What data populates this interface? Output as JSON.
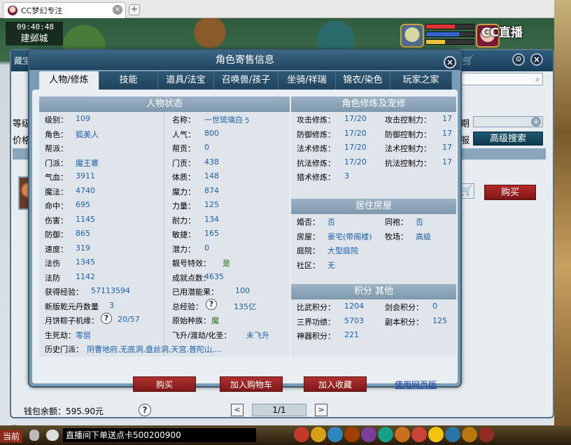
{
  "browser": {
    "tab_title": "CC梦幻专注",
    "tab_close": "×",
    "new_tab": "+"
  },
  "hud": {
    "time": "09:40:48",
    "location": "建邺城",
    "logo": "CC直播"
  },
  "shop": {
    "title": "藏宝",
    "level_label": "等级",
    "price_label": "价格",
    "right_label1": "期",
    "right_label2": "服",
    "advanced_search": "高级搜索",
    "buy": "购买",
    "wallet": "钱包余额：595.90元",
    "help": "?",
    "page": "1/1",
    "prev": "<",
    "next": ">"
  },
  "dialog": {
    "title": "角色寄售信息",
    "close": "×",
    "tabs": [
      "人物/修炼",
      "技能",
      "道具/法宝",
      "召唤兽/孩子",
      "坐骑/祥瑞",
      "锦衣/染色",
      "玩家之家"
    ],
    "left_header": "人物状态",
    "left_rows": [
      {
        "k1": "级别：",
        "v1": "109",
        "k2": "名称：",
        "v2": "一世琉璃白ぅ"
      },
      {
        "k1": "角色：",
        "v1": "狐美人",
        "k2": "人气：",
        "v2": "800"
      },
      {
        "k1": "帮派：",
        "v1": "",
        "k2": "帮贡：",
        "v2": "0"
      },
      {
        "k1": "门派：",
        "v1": "魔王寨",
        "k2": "门贡：",
        "v2": "438"
      },
      {
        "k1": "气血：",
        "v1": "3911",
        "k2": "体质：",
        "v2": "148"
      },
      {
        "k1": "魔法：",
        "v1": "4740",
        "k2": "魔力：",
        "v2": "874"
      },
      {
        "k1": "命中：",
        "v1": "695",
        "k2": "力量：",
        "v2": "125"
      },
      {
        "k1": "伤害：",
        "v1": "1145",
        "k2": "耐力：",
        "v2": "134"
      },
      {
        "k1": "防御：",
        "v1": "865",
        "k2": "敏捷：",
        "v2": "165"
      },
      {
        "k1": "速度：",
        "v1": "319",
        "k2": "潜力：",
        "v2": "0"
      },
      {
        "k1": "法伤",
        "v1": "1345",
        "k2": "靓号特效：",
        "v2": "是"
      },
      {
        "k1": "法防",
        "v1": "1142",
        "k2": "成就点数：",
        "v2": "4635"
      },
      {
        "k1": "获得经验：",
        "v1": "57113594",
        "k2": "已用潜能果：",
        "v2": "100"
      },
      {
        "k1": "新版乾元丹数量",
        "v1": "3",
        "k2": "总经验：",
        "v2": "135亿"
      },
      {
        "k1": "月饼粽子机缘：",
        "v1": "20/57",
        "k2": "原始种族：",
        "v2": "魔"
      },
      {
        "k1": "生死劫：",
        "v1": "零层",
        "k2": "飞升/渡劫/化圣：",
        "v2": "未飞升"
      },
      {
        "k1": "历史门派：",
        "v1": "阴曹地府,无底洞,盘丝洞,天宫,普陀山,...",
        "k2": "",
        "v2": ""
      }
    ],
    "right_sections": {
      "train_header": "角色修炼及宠修",
      "train_rows": [
        {
          "k1": "攻击修炼：",
          "v1": "17/20",
          "k2": "攻击控制力：",
          "v2": "17"
        },
        {
          "k1": "防御修炼：",
          "v1": "17/20",
          "k2": "防御控制力：",
          "v2": "17"
        },
        {
          "k1": "法术修炼：",
          "v1": "17/20",
          "k2": "法术控制力：",
          "v2": "17"
        },
        {
          "k1": "抗法修炼：",
          "v1": "17/20",
          "k2": "抗法控制力：",
          "v2": "17"
        },
        {
          "k1": "猎术修炼：",
          "v1": "3",
          "k2": "",
          "v2": ""
        }
      ],
      "house_header": "居住房屋",
      "house_rows": [
        {
          "k1": "婚否：",
          "v1": "否",
          "k2": "同袍：",
          "v2": "否"
        },
        {
          "k1": "房屋：",
          "v1": "豪宅(带阁楼)",
          "k2": "牧场：",
          "v2": "高级"
        },
        {
          "k1": "庭院：",
          "v1": "大型庭院",
          "k2": "",
          "v2": ""
        },
        {
          "k1": "社区：",
          "v1": "无",
          "k2": "",
          "v2": ""
        }
      ],
      "score_header": "积分 其他",
      "score_rows": [
        {
          "k1": "比武积分：",
          "v1": "1204",
          "k2": "剑会积分：",
          "v2": "0"
        },
        {
          "k1": "三界功绩：",
          "v1": "5703",
          "k2": "副本积分：",
          "v2": "125"
        },
        {
          "k1": "神器积分：",
          "v1": "221",
          "k2": "",
          "v2": ""
        }
      ]
    },
    "help_mark": "?",
    "buttons": {
      "buy": "购买",
      "add_cart": "加入购物车",
      "add_fav": "加入收藏",
      "web": "使用网页版"
    }
  },
  "taskbar": {
    "now": "当前",
    "ticker": "直播间下单送点卡500200900"
  }
}
